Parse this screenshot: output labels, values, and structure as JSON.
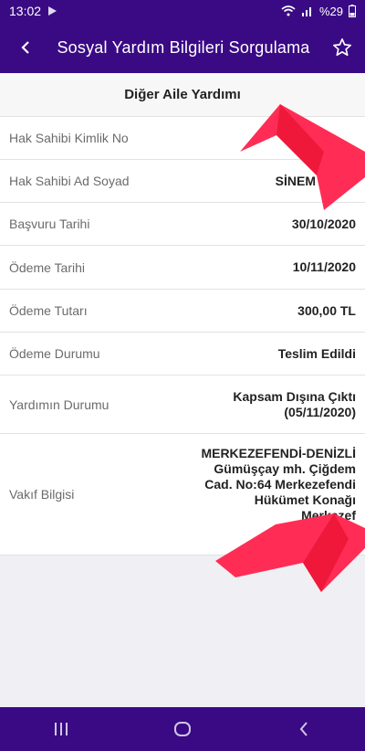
{
  "status": {
    "time": "13:02",
    "battery": "%29"
  },
  "app_bar": {
    "title": "Sosyal Yardım Bilgileri Sorgulama"
  },
  "card": {
    "header": "Diğer Aile Yardımı",
    "rows": [
      {
        "label": "Hak Sahibi Kimlik No",
        "value": ""
      },
      {
        "label": "Hak Sahibi Ad Soyad",
        "value": "SİNEM"
      },
      {
        "label": "Başvuru Tarihi",
        "value": "30/10/2020"
      },
      {
        "label": "Ödeme Tarihi",
        "value": "10/11/2020"
      },
      {
        "label": "Ödeme Tutarı",
        "value": "300,00 TL"
      },
      {
        "label": "Ödeme Durumu",
        "value": "Teslim Edildi"
      },
      {
        "label": "Yardımın Durumu",
        "value": "Kapsam Dışına Çıktı\n(05/11/2020)"
      },
      {
        "label": "Vakıf Bilgisi",
        "value": "MERKEZEFENDİ-DENİZLİ\nGümüşçay mh. Çiğdem\nCad. No:64 Merkezefendi\nHükümet Konağı\nMerkezef"
      }
    ]
  },
  "colors": {
    "accent": "#3a0a85",
    "redaction": "#ff2d55"
  }
}
